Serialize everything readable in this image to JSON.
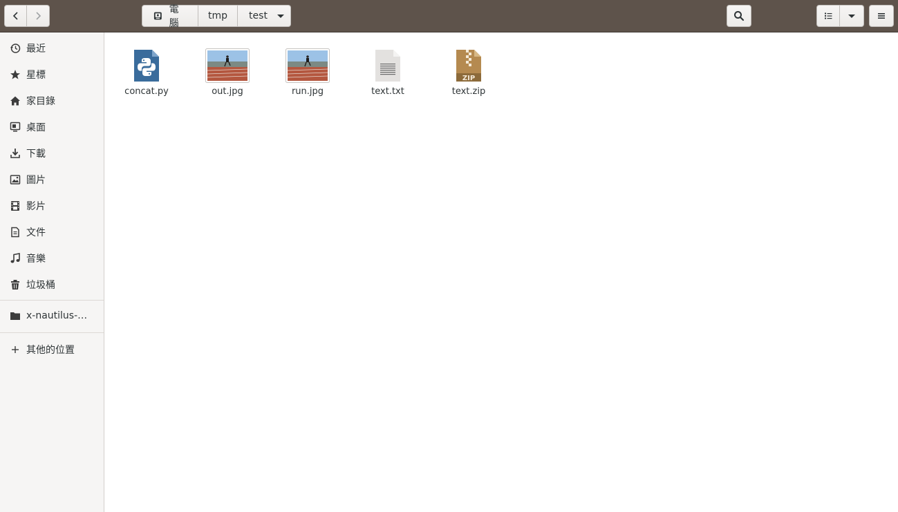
{
  "header": {
    "back_icon": "chevron-left-icon",
    "forward_icon": "chevron-right-icon",
    "path": [
      {
        "label": "電腦",
        "icon": "computer-icon"
      },
      {
        "label": "tmp"
      },
      {
        "label": "test"
      }
    ],
    "path_menu_icon": "caret-down-icon",
    "search_icon": "search-icon",
    "view_list_icon": "list-view-icon",
    "view_options_icon": "caret-down-icon",
    "menu_icon": "hamburger-menu-icon"
  },
  "sidebar": {
    "places": [
      {
        "label": "最近",
        "icon": "recent-icon"
      },
      {
        "label": "星標",
        "icon": "star-icon"
      },
      {
        "label": "家目錄",
        "icon": "home-icon"
      },
      {
        "label": "桌面",
        "icon": "desktop-icon"
      },
      {
        "label": "下載",
        "icon": "download-icon"
      },
      {
        "label": "圖片",
        "icon": "pictures-icon"
      },
      {
        "label": "影片",
        "icon": "video-icon"
      },
      {
        "label": "文件",
        "icon": "document-icon"
      },
      {
        "label": "音樂",
        "icon": "music-icon"
      },
      {
        "label": "垃圾桶",
        "icon": "trash-icon"
      }
    ],
    "bookmarks": [
      {
        "label": "x-nautilus-de…",
        "icon": "folder-icon"
      }
    ],
    "other_locations": {
      "label": "其他的位置",
      "icon": "plus-icon"
    }
  },
  "files": [
    {
      "name": "concat.py",
      "type": "python",
      "icon": "python-file-icon"
    },
    {
      "name": "out.jpg",
      "type": "image",
      "icon": "image-thumbnail-icon"
    },
    {
      "name": "run.jpg",
      "type": "image",
      "icon": "image-thumbnail-icon"
    },
    {
      "name": "text.txt",
      "type": "text",
      "icon": "text-file-icon"
    },
    {
      "name": "text.zip",
      "type": "archive",
      "icon": "zip-file-icon"
    }
  ],
  "colors": {
    "headerbar": "#5e534b",
    "sidebar_bg": "#f6f5f4",
    "python_blue": "#3a6c9c",
    "zip_brown": "#b58a50"
  }
}
